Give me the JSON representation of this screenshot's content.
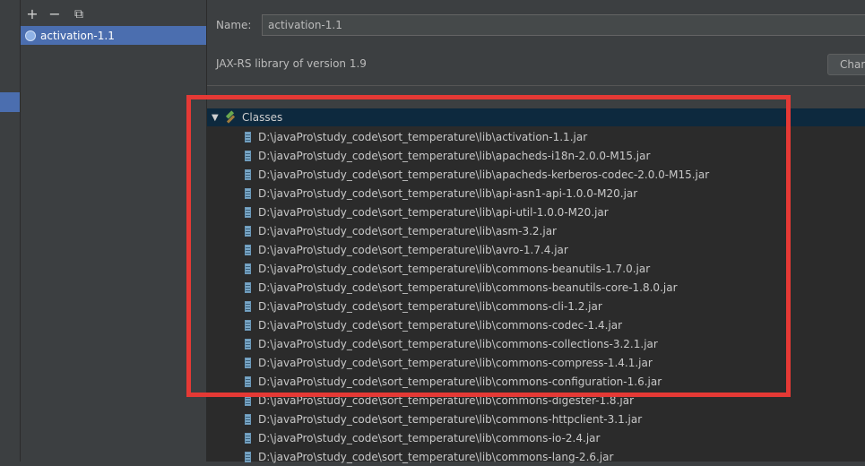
{
  "toolbar": {
    "add_symbol": "+",
    "remove_symbol": "−",
    "copy_symbol": "⧉"
  },
  "library_list": {
    "items": [
      {
        "label": "activation-1.1",
        "icon": "globe-icon"
      }
    ]
  },
  "details": {
    "name_label": "Name:",
    "name_value": "activation-1.1",
    "description": "JAX-RS library of version 1.9",
    "change_button": "Chan"
  },
  "tree": {
    "root_label": "Classes",
    "entries": [
      "D:\\javaPro\\study_code\\sort_temperature\\lib\\activation-1.1.jar",
      "D:\\javaPro\\study_code\\sort_temperature\\lib\\apacheds-i18n-2.0.0-M15.jar",
      "D:\\javaPro\\study_code\\sort_temperature\\lib\\apacheds-kerberos-codec-2.0.0-M15.jar",
      "D:\\javaPro\\study_code\\sort_temperature\\lib\\api-asn1-api-1.0.0-M20.jar",
      "D:\\javaPro\\study_code\\sort_temperature\\lib\\api-util-1.0.0-M20.jar",
      "D:\\javaPro\\study_code\\sort_temperature\\lib\\asm-3.2.jar",
      "D:\\javaPro\\study_code\\sort_temperature\\lib\\avro-1.7.4.jar",
      "D:\\javaPro\\study_code\\sort_temperature\\lib\\commons-beanutils-1.7.0.jar",
      "D:\\javaPro\\study_code\\sort_temperature\\lib\\commons-beanutils-core-1.8.0.jar",
      "D:\\javaPro\\study_code\\sort_temperature\\lib\\commons-cli-1.2.jar",
      "D:\\javaPro\\study_code\\sort_temperature\\lib\\commons-codec-1.4.jar",
      "D:\\javaPro\\study_code\\sort_temperature\\lib\\commons-collections-3.2.1.jar",
      "D:\\javaPro\\study_code\\sort_temperature\\lib\\commons-compress-1.4.1.jar",
      "D:\\javaPro\\study_code\\sort_temperature\\lib\\commons-configuration-1.6.jar",
      "D:\\javaPro\\study_code\\sort_temperature\\lib\\commons-digester-1.8.jar",
      "D:\\javaPro\\study_code\\sort_temperature\\lib\\commons-httpclient-3.1.jar",
      "D:\\javaPro\\study_code\\sort_temperature\\lib\\commons-io-2.4.jar",
      "D:\\javaPro\\study_code\\sort_temperature\\lib\\commons-lang-2.6.jar"
    ]
  },
  "colors": {
    "selection": "#4b6eaf",
    "tree_background": "#2b2b2b",
    "annotation_box": "#e53935"
  }
}
